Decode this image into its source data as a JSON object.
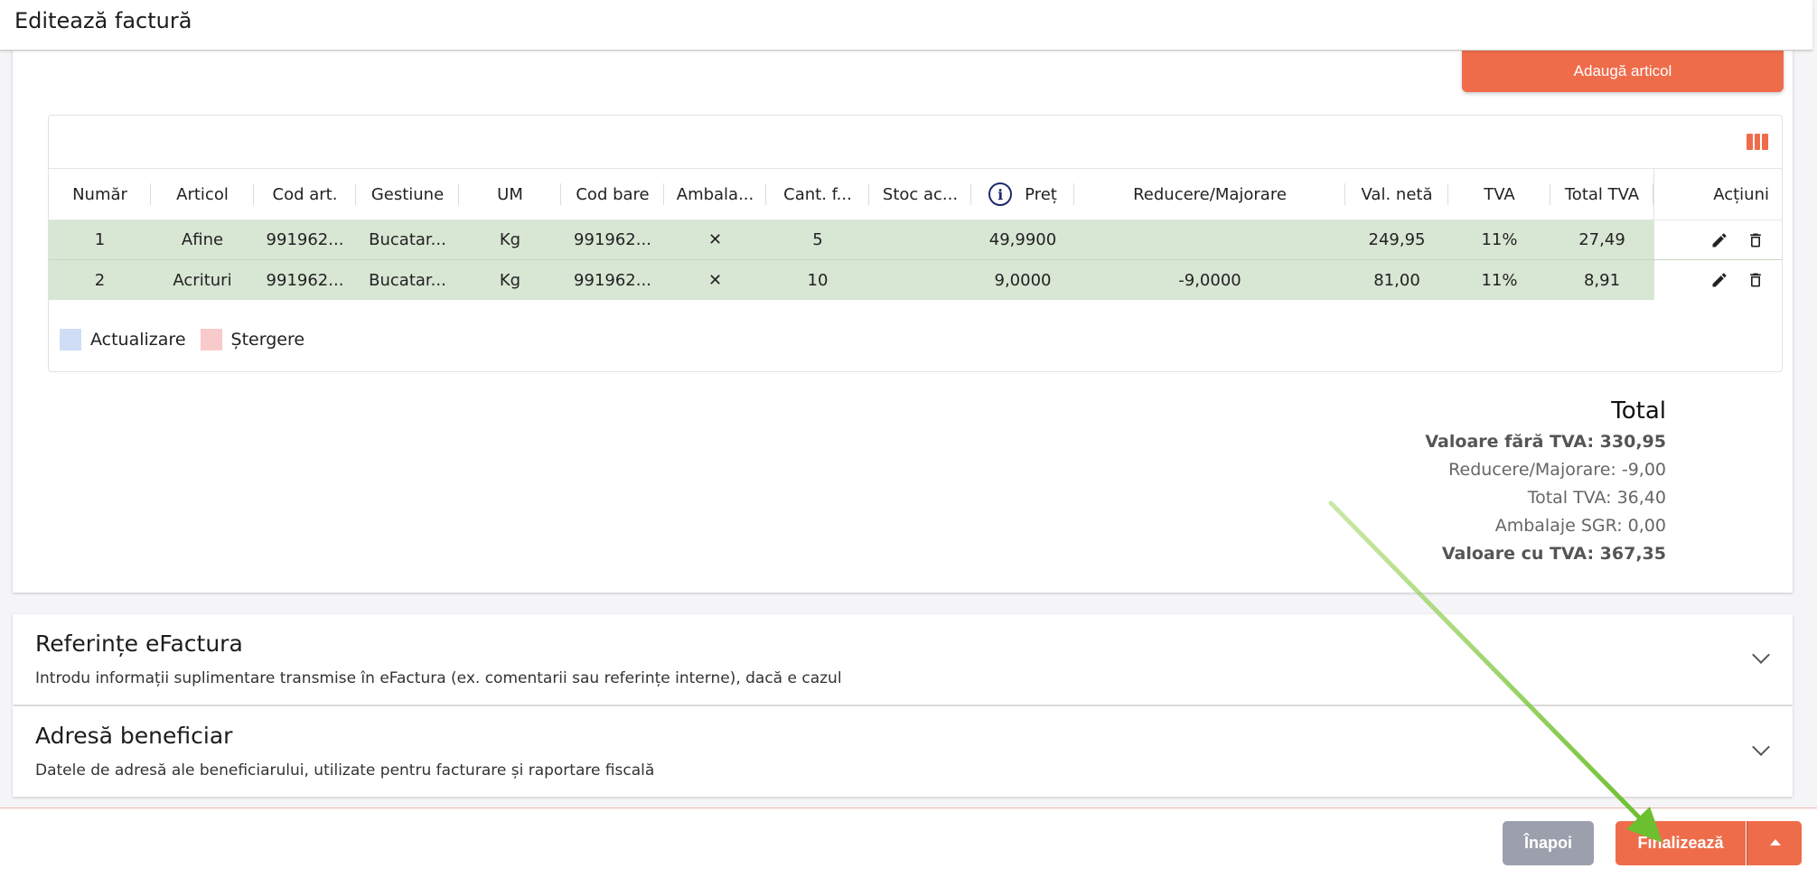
{
  "header": {
    "title": "Editează factură"
  },
  "items_card": {
    "add_button": "Adaugă articol",
    "columns": [
      "Număr",
      "Articol",
      "Cod art.",
      "Gestiune",
      "UM",
      "Cod bare",
      "Ambala...",
      "Cant. f...",
      "Stoc ac...",
      "Preț",
      "Reducere/Majorare",
      "Val. netă",
      "TVA",
      "Total TVA",
      "Acțiuni"
    ],
    "rows": [
      {
        "nr": "1",
        "articol": "Afine",
        "cod_art": "991962...",
        "gestiune": "Bucatar...",
        "um": "Kg",
        "cod_bare": "991962...",
        "ambalaj": "✕",
        "cant": "5",
        "stoc": "",
        "pret": "49,9900",
        "reducere": "",
        "val_neta": "249,95",
        "tva": "11%",
        "total_tva": "27,49"
      },
      {
        "nr": "2",
        "articol": "Acrituri",
        "cod_art": "991962...",
        "gestiune": "Bucatar...",
        "um": "Kg",
        "cod_bare": "991962...",
        "ambalaj": "✕",
        "cant": "10",
        "stoc": "",
        "pret": "9,0000",
        "reducere": "-9,0000",
        "val_neta": "81,00",
        "tva": "11%",
        "total_tva": "8,91"
      }
    ],
    "legend": {
      "update": "Actualizare",
      "delete": "Ștergere"
    },
    "totals": {
      "title": "Total",
      "fara_tva": "Valoare fără TVA: 330,95",
      "reducere": "Reducere/Majorare: -9,00",
      "total_tva": "Total TVA: 36,40",
      "ambalaje": "Ambalaje SGR: 0,00",
      "cu_tva": "Valoare cu TVA: 367,35"
    }
  },
  "sections": {
    "efactura": {
      "title": "Referințe eFactura",
      "subtitle": "Introdu informații suplimentare transmise în eFactura (ex. comentarii sau referințe interne), dacă e cazul"
    },
    "adresa": {
      "title": "Adresă beneficiar",
      "subtitle": "Datele de adresă ale beneficiarului, utilizate pentru facturare și raportare fiscală"
    }
  },
  "footer": {
    "back": "Înapoi",
    "finalize": "Finalizează"
  },
  "colors": {
    "accent": "#ef6c4a",
    "row_bg": "#d8e6d4",
    "legend_update": "#cfddf6",
    "legend_delete": "#f9cacb",
    "arrow": "#7dc242"
  }
}
